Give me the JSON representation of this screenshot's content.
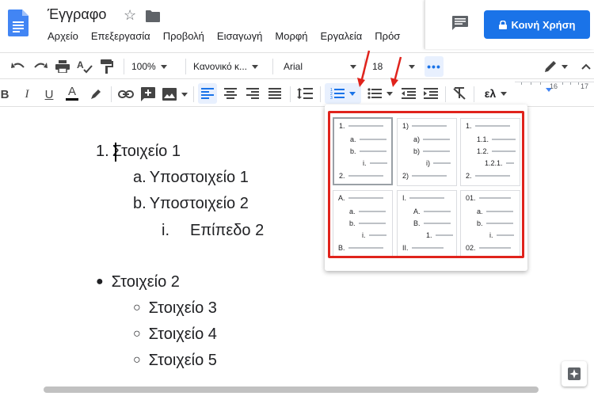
{
  "header": {
    "doc_title": "Έγγραφο",
    "menus": [
      "Αρχείο",
      "Επεξεργασία",
      "Προβολή",
      "Εισαγωγή",
      "Μορφή",
      "Εργαλεία",
      "Πρόσ"
    ],
    "share_label": "Κοινή Χρήση"
  },
  "toolbar": {
    "zoom": "100%",
    "style": "Κανονικό κ...",
    "font": "Arial",
    "font_size": "18",
    "input_tools": "ελ"
  },
  "ruler": {
    "marks": [
      "16",
      "17"
    ]
  },
  "document": {
    "lines": [
      {
        "marker": "1.",
        "text": "Στοιχείο 1"
      },
      {
        "marker": "a.",
        "text": "Υποστοιχείο 1"
      },
      {
        "marker": "b.",
        "text": "Υποστοιχείο 2"
      },
      {
        "marker": "i.",
        "text": "Επίπεδο 2"
      },
      {
        "marker": "●",
        "text": "Στοιχείο 2"
      },
      {
        "marker": "○",
        "text": "Στοιχείο 3"
      },
      {
        "marker": "○",
        "text": "Στοιχείο 4"
      },
      {
        "marker": "○",
        "text": "Στοιχείο 5"
      }
    ]
  },
  "numbered_list_presets": [
    {
      "rows": [
        "1.",
        "a.",
        "b.",
        "i.",
        "2."
      ]
    },
    {
      "rows": [
        "1)",
        "a)",
        "b)",
        "i)",
        "2)"
      ]
    },
    {
      "rows": [
        "1.",
        "1.1.",
        "1.2.",
        "1.2.1.",
        "2."
      ]
    },
    {
      "rows": [
        "A.",
        "a.",
        "b.",
        "i.",
        "B."
      ]
    },
    {
      "rows": [
        "I.",
        "A.",
        "B.",
        "1.",
        "II."
      ]
    },
    {
      "rows": [
        "01.",
        "a.",
        "b.",
        "i.",
        "02."
      ]
    }
  ],
  "colors": {
    "accent": "#1a73e8",
    "highlight_border": "#e0231c",
    "active_button_bg": "#e8f0fe",
    "doc_icon": "#4285f4"
  }
}
